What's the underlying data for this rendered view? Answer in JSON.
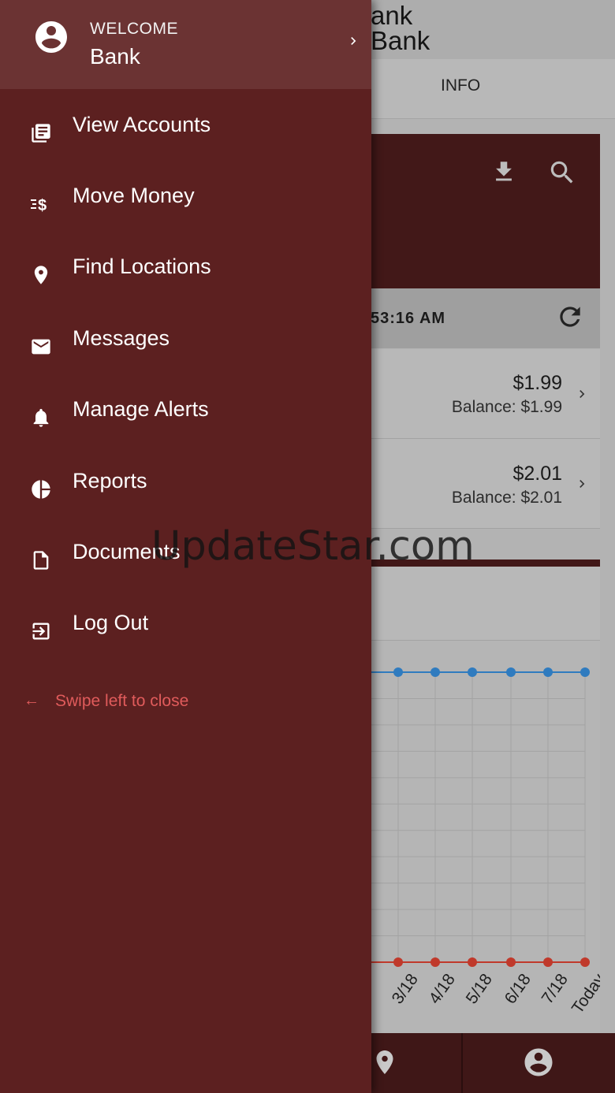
{
  "background": {
    "title_line1": "ank",
    "title_line2": "Bank",
    "tab_info": "INFO",
    "time_text": "53:16 AM",
    "accounts": [
      {
        "amount": "$1.99",
        "balance": "Balance: $1.99"
      },
      {
        "amount": "$2.01",
        "balance": "Balance: $2.01"
      }
    ],
    "hero_icons": [
      "download-icon",
      "search-icon"
    ],
    "bottom_icons": [
      "location-pin-icon",
      "account-circle-icon"
    ]
  },
  "chart_data": {
    "type": "line",
    "categories": [
      "3/18",
      "4/18",
      "5/18",
      "6/18",
      "7/18",
      "Today"
    ],
    "series": [
      {
        "color": "#2f7bbf",
        "values": [
          1,
          1,
          1,
          1,
          1,
          1
        ]
      },
      {
        "color": "#c0392b",
        "values": [
          0,
          0,
          0,
          0,
          0,
          0
        ]
      }
    ],
    "grid": true
  },
  "drawer": {
    "welcome": "WELCOME",
    "name": "Bank",
    "items": [
      {
        "label": "View Accounts",
        "icon": "accounts-icon"
      },
      {
        "label": "Move Money",
        "icon": "move-money-icon"
      },
      {
        "label": "Find Locations",
        "icon": "location-pin-icon"
      },
      {
        "label": "Messages",
        "icon": "mail-icon"
      },
      {
        "label": "Manage Alerts",
        "icon": "bell-icon"
      },
      {
        "label": "Reports",
        "icon": "pie-chart-icon"
      },
      {
        "label": "Documents",
        "icon": "document-icon"
      },
      {
        "label": "Log Out",
        "icon": "logout-icon"
      }
    ],
    "swipe_hint": "Swipe left to close",
    "swipe_arrow": "←"
  },
  "watermark": "UpdateStar.com",
  "colors": {
    "drawer_bg": "#5c2020",
    "drawer_header": "#6b3333",
    "accent_dark": "#421818",
    "hint_red": "#e05b5b"
  }
}
